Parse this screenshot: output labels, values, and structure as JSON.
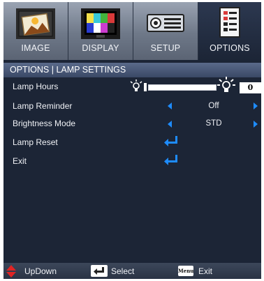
{
  "tabs": [
    {
      "label": "IMAGE",
      "icon": "image-icon"
    },
    {
      "label": "DISPLAY",
      "icon": "display-icon"
    },
    {
      "label": "SETUP",
      "icon": "setup-icon"
    },
    {
      "label": "OPTIONS",
      "icon": "options-icon",
      "active": true
    }
  ],
  "header": {
    "title": "OPTIONS | LAMP SETTINGS"
  },
  "rows": {
    "lamp_hours": {
      "label": "Lamp Hours",
      "value": "0",
      "slider_fraction": 0.0
    },
    "lamp_reminder": {
      "label": "Lamp Reminder",
      "value": "Off"
    },
    "brightness_mode": {
      "label": "Brightness Mode",
      "value": "STD"
    },
    "lamp_reset": {
      "label": "Lamp Reset"
    },
    "exit": {
      "label": "Exit"
    }
  },
  "footer": {
    "updown": "UpDown",
    "select": "Select",
    "menu_key": "Menu",
    "exit": "Exit"
  },
  "colors": {
    "background": "#1c2536",
    "accent_arrow": "#1e8cff",
    "enter_icon": "#1e8cff",
    "updown_icon": "#e02424"
  }
}
